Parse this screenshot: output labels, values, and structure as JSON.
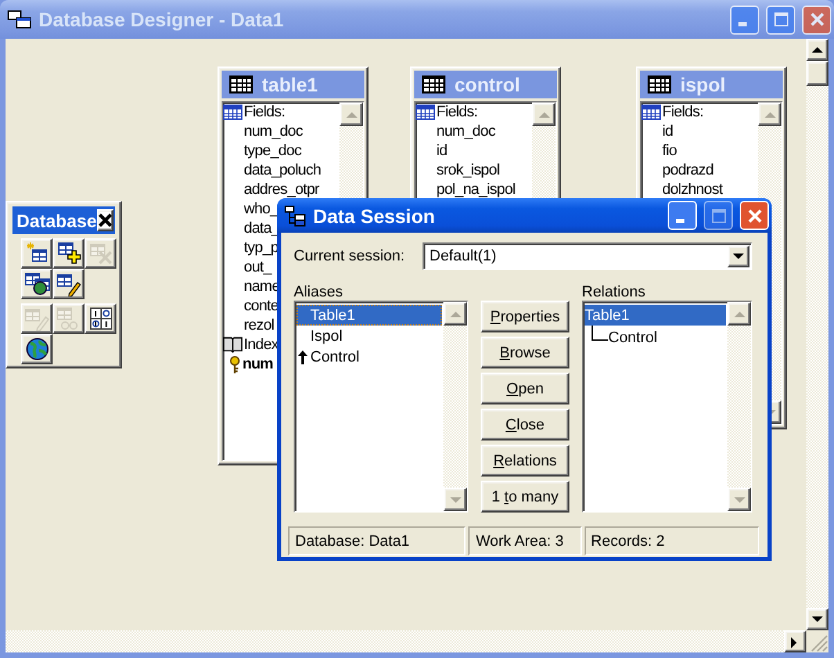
{
  "window": {
    "title": "Database Designer - Data1",
    "active": false
  },
  "tables": [
    {
      "name": "table1",
      "items": [
        {
          "kind": "section",
          "text": "Fields:"
        },
        {
          "kind": "field",
          "text": "num_doc"
        },
        {
          "kind": "field",
          "text": "type_doc"
        },
        {
          "kind": "field",
          "text": "data_poluch"
        },
        {
          "kind": "field",
          "text": "addres_otpr"
        },
        {
          "kind": "field",
          "text": "who_"
        },
        {
          "kind": "field",
          "text": "data_"
        },
        {
          "kind": "field",
          "text": "typ_p"
        },
        {
          "kind": "field",
          "text": "out_"
        },
        {
          "kind": "field",
          "text": "name"
        },
        {
          "kind": "field",
          "text": "conte"
        },
        {
          "kind": "field",
          "text": "rezol"
        },
        {
          "kind": "index_section",
          "text": "Index"
        },
        {
          "kind": "key",
          "text": "num"
        }
      ]
    },
    {
      "name": "control",
      "items": [
        {
          "kind": "section",
          "text": "Fields:"
        },
        {
          "kind": "field",
          "text": "num_doc"
        },
        {
          "kind": "field",
          "text": "id"
        },
        {
          "kind": "field",
          "text": "srok_ispol"
        },
        {
          "kind": "field",
          "text": "pol_na_ispol"
        }
      ]
    },
    {
      "name": "ispol",
      "items": [
        {
          "kind": "section",
          "text": "Fields:"
        },
        {
          "kind": "field",
          "text": "id"
        },
        {
          "kind": "field",
          "text": "fio"
        },
        {
          "kind": "field",
          "text": "podrazd"
        },
        {
          "kind": "field",
          "text": "dolzhnost"
        }
      ]
    }
  ],
  "toolbar": {
    "title": "Database",
    "groups": [
      [
        {
          "kind": "new",
          "disabled": false
        },
        {
          "kind": "add",
          "disabled": false
        },
        {
          "kind": "remove",
          "disabled": true
        },
        {
          "kind": "connect",
          "disabled": false
        },
        {
          "kind": "modify",
          "disabled": false
        }
      ],
      [
        {
          "kind": "edit",
          "disabled": true
        },
        {
          "kind": "browse",
          "disabled": true
        },
        {
          "kind": "code",
          "disabled": false
        },
        {
          "kind": "globe",
          "disabled": false
        }
      ]
    ]
  },
  "dialog": {
    "title": "Data Session",
    "active": true,
    "session_label": "Current session:",
    "session_value": "Default(1)",
    "aliases_label": "Aliases",
    "aliases": [
      {
        "text": "Table1",
        "selected": true,
        "linked": false
      },
      {
        "text": "Ispol",
        "selected": false,
        "linked": false
      },
      {
        "text": "Control",
        "selected": false,
        "linked": true
      }
    ],
    "buttons": [
      {
        "key": "P",
        "after": "roperties"
      },
      {
        "key": "B",
        "after": "rowse"
      },
      {
        "key": "O",
        "after": "pen"
      },
      {
        "key": "C",
        "after": "lose"
      },
      {
        "key": "R",
        "after": "elations"
      },
      {
        "before": "1 ",
        "key": "t",
        "after": "o many"
      }
    ],
    "relations_label": "Relations",
    "relations": [
      {
        "text": "Table1",
        "selected": true,
        "children": [
          {
            "text": "Control",
            "selected": false
          }
        ]
      }
    ],
    "status": [
      "Database: Data1",
      "Work Area: 3",
      "Records: 2"
    ]
  }
}
